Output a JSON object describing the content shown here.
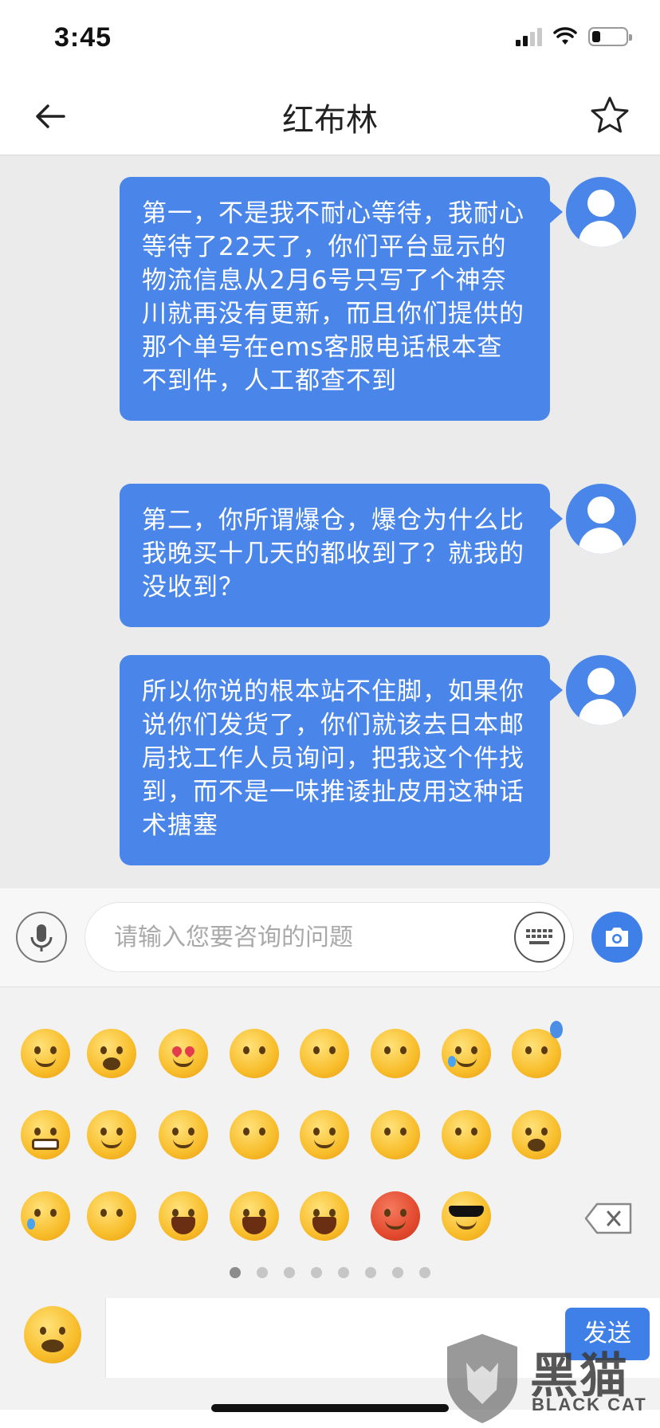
{
  "status_bar": {
    "time": "3:45",
    "battery_level": 0.25
  },
  "header": {
    "title": "红布林"
  },
  "messages": [
    {
      "text": "第一，不是我不耐心等待，我耐心等待了22天了，你们平台显示的物流信息从2月6号只写了个神奈川就再没有更新，而且你们提供的那个单号在ems客服电话根本查不到件，人工都查不到"
    },
    {
      "text": "第二，你所谓爆仓，爆仓为什么比我晚买十几天的都收到了？就我的没收到？"
    },
    {
      "text": "所以你说的根本站不住脚，如果你说你们发货了，你们就该去日本邮局找工作人员询问，把我这个件找到，而不是一味推诿扯皮用这种话术搪塞"
    }
  ],
  "input": {
    "placeholder": "请输入您要咨询的问题",
    "value": ""
  },
  "emoji_pager": {
    "pages": 8,
    "current": 1
  },
  "send_button": {
    "label": "发送"
  },
  "watermark": {
    "cn": "黑猫",
    "en": "BLACK CAT"
  },
  "colors": {
    "accent": "#4a86ea",
    "chat_bg": "#ebebeb",
    "panel_bg": "#f2f2f2"
  },
  "icons": {
    "header": [
      "back-arrow-icon",
      "star-icon"
    ],
    "input_bar": [
      "microphone-icon",
      "keyboard-icon",
      "camera-icon"
    ],
    "emoji_rows": [
      [
        "smiling-face",
        "grinning-face",
        "heart-eyes-face",
        "shushing-face",
        "kissing-face",
        "flushed-face",
        "tears-of-joy-face",
        "downcast-sweat-face"
      ],
      [
        "grimacing-face",
        "winking-tongue-face",
        "relieved-face",
        "hand-over-mouth-face",
        "winking-face",
        "pleading-face",
        "hammer-on-head-face",
        "hushed-face"
      ],
      [
        "crying-face",
        "hands-covering-face",
        "loudly-crying-face",
        "tired-face",
        "screaming-face",
        "angry-face",
        "sunglasses-face",
        "backspace-icon"
      ]
    ]
  }
}
